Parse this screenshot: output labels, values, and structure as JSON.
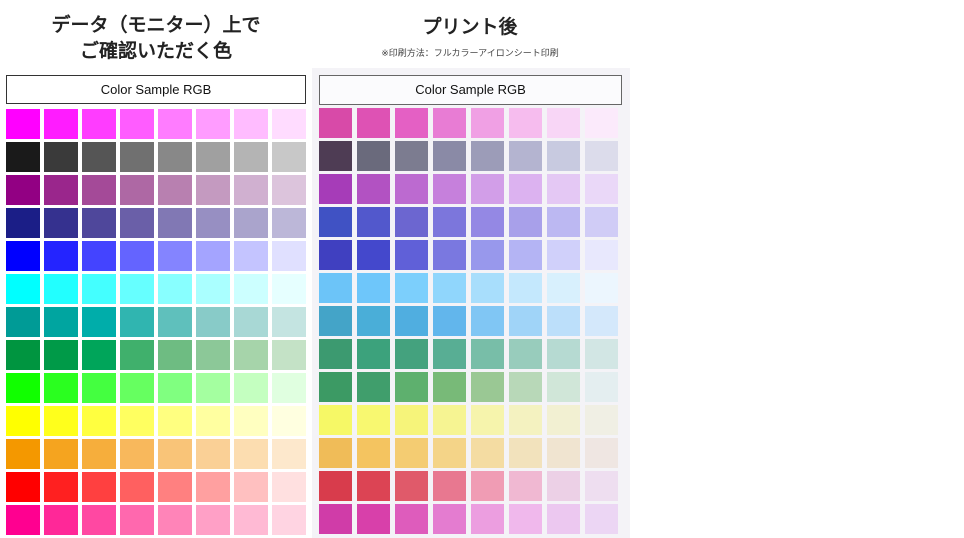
{
  "left": {
    "title_line1": "データ（モニター）上で",
    "title_line2": "ご確認いただく色",
    "label": "Color Sample RGB",
    "rows": [
      [
        "#ff00ff",
        "#ff1cff",
        "#ff3cff",
        "#ff5cff",
        "#ff7cff",
        "#ff9cff",
        "#ffbcff",
        "#ffdcff"
      ],
      [
        "#1a1a1a",
        "#3a3a3a",
        "#555555",
        "#707070",
        "#888888",
        "#a0a0a0",
        "#b4b4b4",
        "#c8c8c8"
      ],
      [
        "#920083",
        "#9a268c",
        "#a44a98",
        "#ae68a4",
        "#b880b0",
        "#c49ac0",
        "#d0b0d0",
        "#dcc4dc"
      ],
      [
        "#1b1e87",
        "#35318f",
        "#4f479b",
        "#6a5fa8",
        "#8178b4",
        "#978fc2",
        "#aaa4cc",
        "#bcb7d8"
      ],
      [
        "#0000ff",
        "#2424ff",
        "#4444ff",
        "#6464ff",
        "#8484ff",
        "#a4a4ff",
        "#c4c4ff",
        "#e0e0ff"
      ],
      [
        "#00ffff",
        "#22ffff",
        "#44ffff",
        "#66ffff",
        "#88ffff",
        "#aaffff",
        "#ccffff",
        "#e6ffff"
      ],
      [
        "#009b96",
        "#00a5a0",
        "#00adaa",
        "#30b5b0",
        "#5fc0bc",
        "#88cbc8",
        "#a8d8d5",
        "#c4e4e1"
      ],
      [
        "#009540",
        "#009a48",
        "#00a55a",
        "#40b06c",
        "#6ebc82",
        "#8cc898",
        "#a6d4aa",
        "#c4e2c6"
      ],
      [
        "#11ff00",
        "#2aff1f",
        "#44ff40",
        "#66ff60",
        "#80ff80",
        "#a4ffa0",
        "#c4ffc0",
        "#e0ffe0"
      ],
      [
        "#ffff00",
        "#ffff1c",
        "#ffff40",
        "#ffff60",
        "#ffff80",
        "#ffffa0",
        "#ffffc0",
        "#ffffe0"
      ],
      [
        "#f49800",
        "#f5a41f",
        "#f6ae3c",
        "#f8b85c",
        "#f9c478",
        "#fad096",
        "#fcddb0",
        "#fde8cc"
      ],
      [
        "#ff0000",
        "#ff2020",
        "#ff4040",
        "#ff6060",
        "#ff8080",
        "#ffa0a0",
        "#ffc0c0",
        "#ffe0e0"
      ],
      [
        "#ff0090",
        "#ff2898",
        "#ff48a2",
        "#ff68ae",
        "#ff84b8",
        "#ffa0c6",
        "#ffbad4",
        "#ffd4e2"
      ]
    ]
  },
  "right": {
    "title": "プリント後",
    "note": "※印刷方法：フルカラーアイロンシート印刷",
    "label": "Color Sample RGB",
    "rows": [
      [
        "#d84aa8",
        "#de52b4",
        "#e460c4",
        "#e87cd4",
        "#f0a0e4",
        "#f6bcee",
        "#f8d6f6",
        "#fbeafb"
      ],
      [
        "#4e3c54",
        "#6a6a7c",
        "#7c7c90",
        "#8a8aa6",
        "#9c9cb8",
        "#b4b4d0",
        "#c8cae0",
        "#dcdceb"
      ],
      [
        "#a63cb8",
        "#b252c2",
        "#bc6ad0",
        "#c680dc",
        "#d29ee8",
        "#dcb2f0",
        "#e4c8f4",
        "#ead8f8"
      ],
      [
        "#4052c4",
        "#5258cc",
        "#6c66d0",
        "#7c76dc",
        "#9488e4",
        "#a8a0ea",
        "#bcb8f2",
        "#d0ccf6"
      ],
      [
        "#4040c0",
        "#4448cc",
        "#6060d8",
        "#7a78e0",
        "#9898ec",
        "#b4b4f4",
        "#d0d0fa",
        "#e8e8fd"
      ],
      [
        "#6cc4f8",
        "#6ec6fa",
        "#7ccffc",
        "#90d6fc",
        "#a8defc",
        "#c4e8fd",
        "#d8f0fd",
        "#ecf6fe"
      ],
      [
        "#44a4c8",
        "#4aaed8",
        "#50aee0",
        "#62b6ec",
        "#80c6f4",
        "#a0d4f8",
        "#bcdffa",
        "#d4e8fb"
      ],
      [
        "#3c9a70",
        "#3ca27c",
        "#44a27e",
        "#58ae94",
        "#78bea8",
        "#98ccbc",
        "#b6dad2",
        "#d2e6e4"
      ],
      [
        "#3c9a64",
        "#409e6c",
        "#5eb06e",
        "#78ba78",
        "#9ac894",
        "#b8d8b8",
        "#d0e6d8",
        "#e4eef0"
      ],
      [
        "#f6f866",
        "#f8f870",
        "#f6f47a",
        "#f6f492",
        "#f6f4ac",
        "#f4f2c0",
        "#f2f0d2",
        "#f0efe4"
      ],
      [
        "#f0bc58",
        "#f4c460",
        "#f4cc72",
        "#f4d488",
        "#f4dca2",
        "#f2e2bc",
        "#f0e4d0",
        "#efe6e2"
      ],
      [
        "#d83c4c",
        "#dc4454",
        "#e05a6a",
        "#e87890",
        "#f09cb4",
        "#f0b8d2",
        "#ecd0e6",
        "#eedef0"
      ],
      [
        "#d03ca8",
        "#d840aa",
        "#de5cbc",
        "#e47cd0",
        "#ec9ee0",
        "#f0b8ec",
        "#ecc8f0",
        "#ecd6f4"
      ]
    ]
  }
}
